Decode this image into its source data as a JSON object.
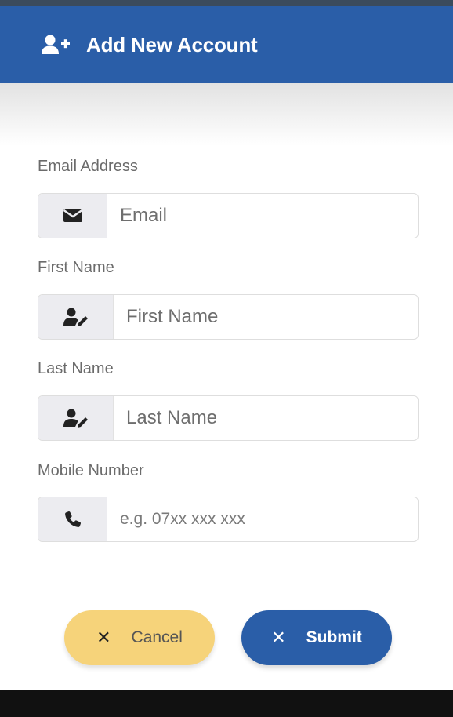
{
  "header": {
    "title": "Add New Account",
    "icon": "user-plus-icon",
    "color": "#2a5ea8"
  },
  "form": {
    "email": {
      "label": "Email Address",
      "placeholder": "Email",
      "icon": "envelope-icon"
    },
    "first_name": {
      "label": "First Name",
      "placeholder": "First Name",
      "icon": "user-edit-icon"
    },
    "last_name": {
      "label": "Last Name",
      "placeholder": "Last Name",
      "icon": "user-edit-icon"
    },
    "mobile": {
      "label": "Mobile Number",
      "placeholder": "e.g. 07xx xxx xxx",
      "icon": "phone-icon"
    }
  },
  "buttons": {
    "cancel_label": "Cancel",
    "submit_label": "Submit",
    "cancel_color": "#f6d37a",
    "submit_color": "#2a5ea8"
  }
}
